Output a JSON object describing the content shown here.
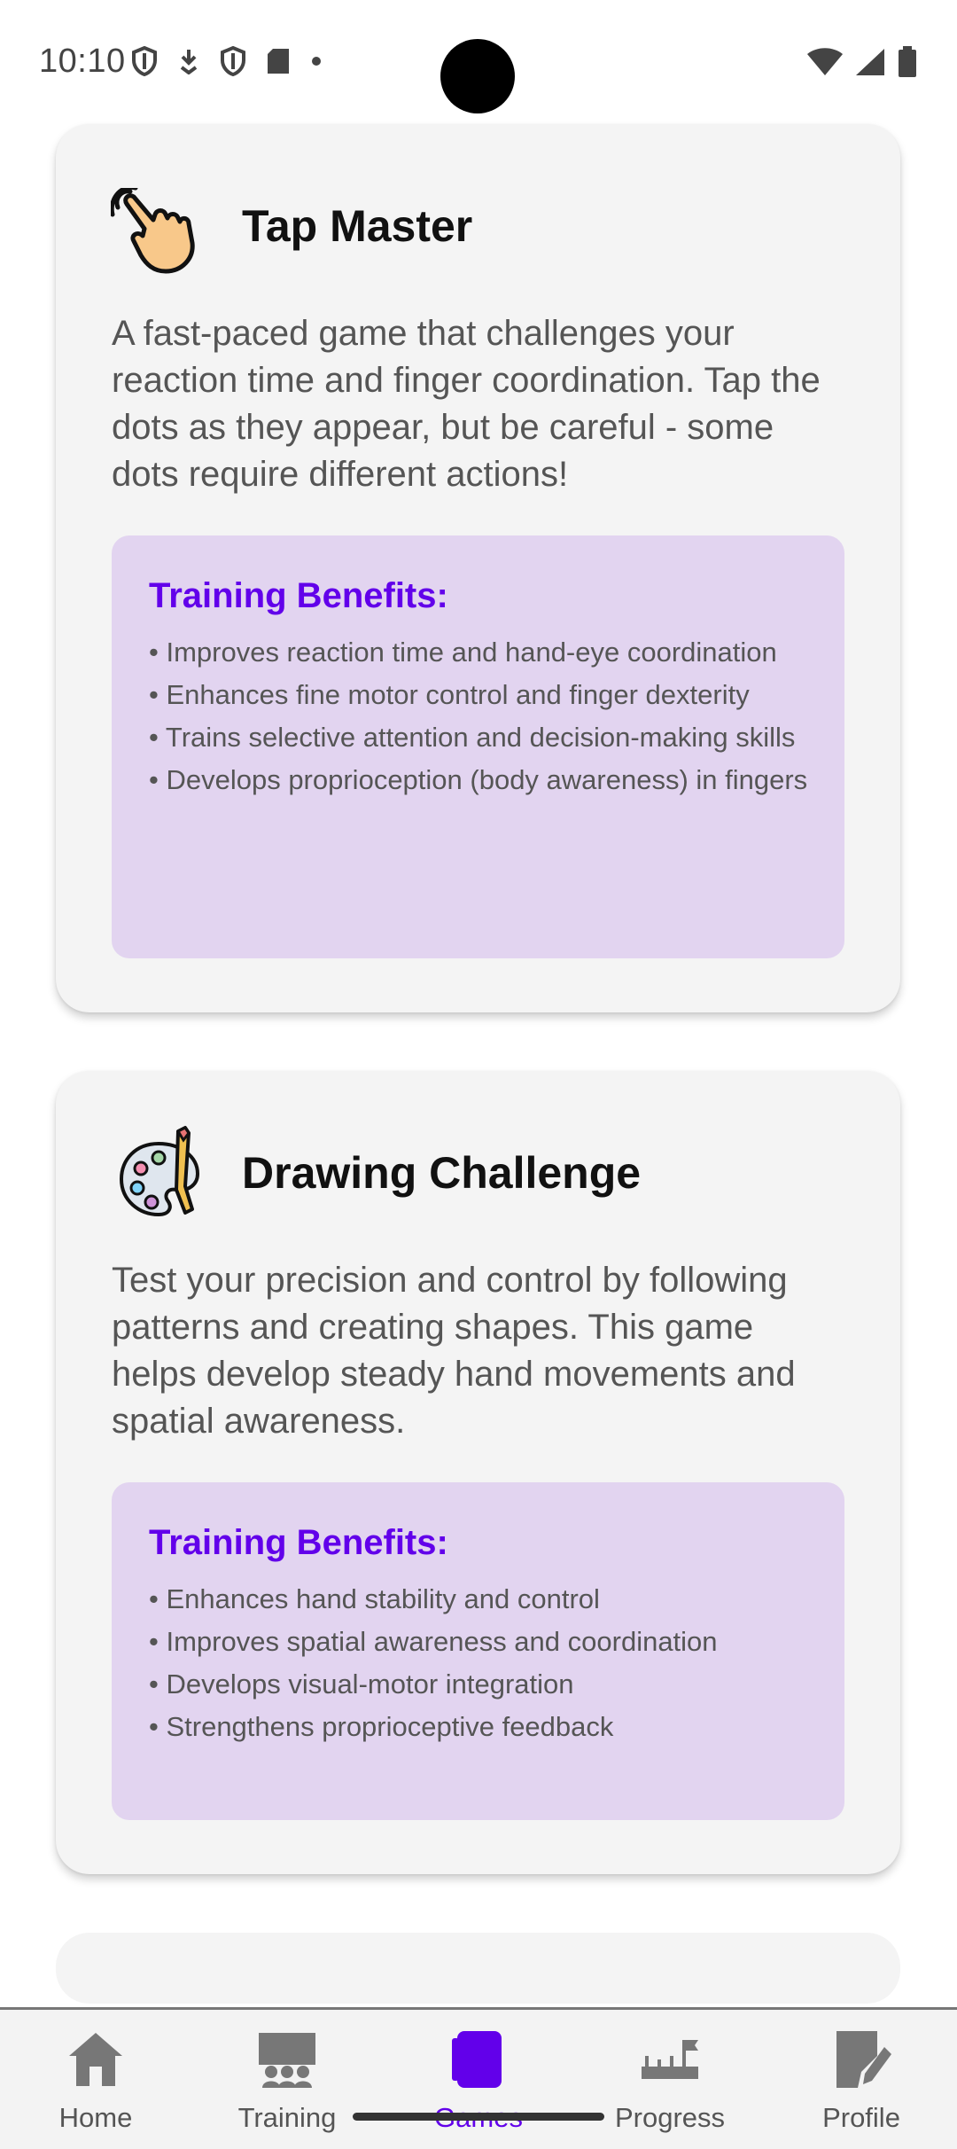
{
  "status_bar": {
    "time": "10:10"
  },
  "cards": [
    {
      "icon": "tapping-hand-icon",
      "title": "Tap Master",
      "description": "A fast-paced game that challenges your reaction time and finger coordination. Tap the dots as they appear, but be careful - some dots require different actions!",
      "benefits_title": "Training Benefits:",
      "benefits": [
        "• Improves reaction time and hand-eye coordination",
        "• Enhances fine motor control and finger dexterity",
        "• Trains selective attention and decision-making skills",
        "• Develops proprioception (body awareness) in fingers"
      ]
    },
    {
      "icon": "paint-palette-icon",
      "title": "Drawing Challenge",
      "description": "Test your precision and control by following patterns and creating shapes. This game helps develop steady hand movements and spatial awareness.",
      "benefits_title": "Training Benefits:",
      "benefits": [
        "• Enhances hand stability and control",
        "• Improves spatial awareness and coordination",
        "• Develops visual-motor integration",
        "• Strengthens proprioceptive feedback"
      ]
    }
  ],
  "bottom_nav": {
    "items": [
      {
        "label": "Home",
        "icon": "home-icon"
      },
      {
        "label": "Training",
        "icon": "training-icon"
      },
      {
        "label": "Games",
        "icon": "games-icon"
      },
      {
        "label": "Progress",
        "icon": "progress-icon"
      },
      {
        "label": "Profile",
        "icon": "profile-icon"
      }
    ],
    "active": "Games"
  },
  "colors": {
    "accent": "#6200ea",
    "benefits_bg": "#e2d4f0",
    "card_bg": "#f4f4f4"
  }
}
